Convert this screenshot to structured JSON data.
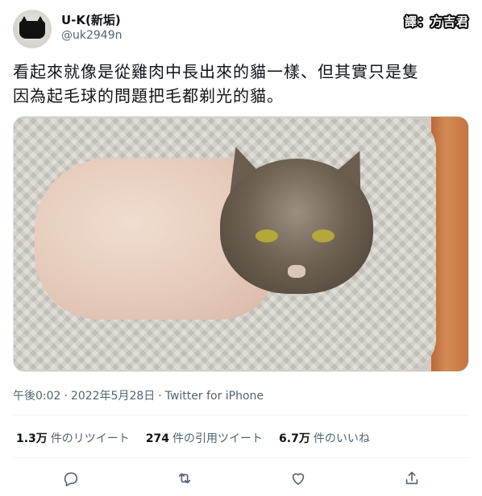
{
  "user": {
    "display_name": "U-K(新垢)",
    "handle": "@uk2949n"
  },
  "translator_badge": "譯：方吉君",
  "tweet": {
    "text_line1": "看起來就像是從雞肉中長出來的貓一樣、但其實只是隻",
    "text_line2": "因為起毛球的問題把毛都剃光的貓。"
  },
  "meta": {
    "time": "午後0:02",
    "date": "2022年5月28日",
    "source": "Twitter for iPhone"
  },
  "stats": {
    "retweets_value": "1.3万",
    "retweets_label": "件のリツイート",
    "quotes_value": "274",
    "quotes_label": "件の引用ツイート",
    "likes_value": "6.7万",
    "likes_label": "件のいいね"
  },
  "actions": {
    "reply_icon": "reply-icon",
    "retweet_icon": "retweet-icon",
    "like_icon": "heart-icon",
    "share_icon": "share-icon"
  },
  "colors": {
    "text_primary": "#0f1419",
    "text_secondary": "#536471"
  }
}
